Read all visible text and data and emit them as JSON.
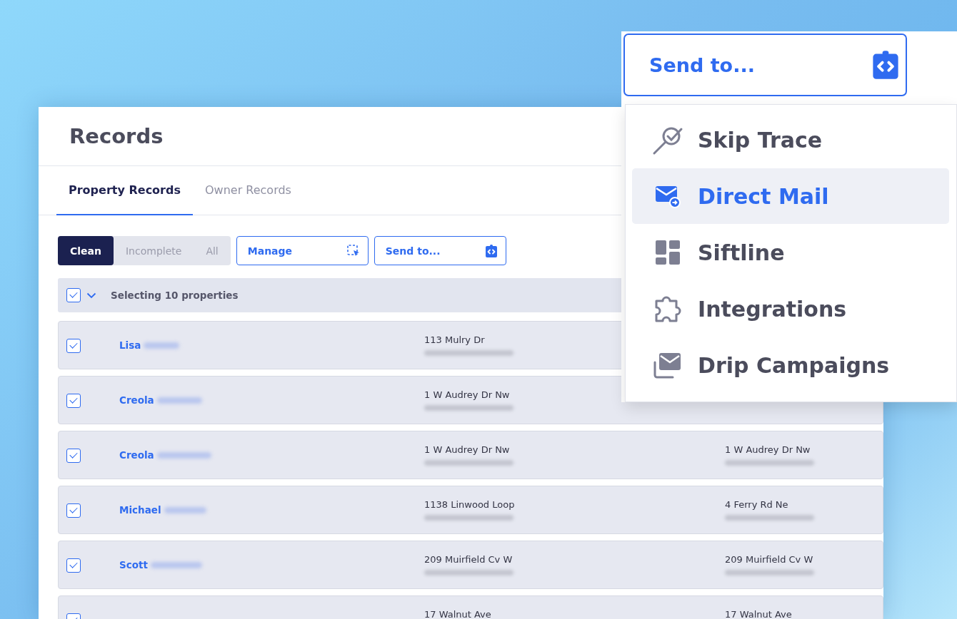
{
  "panel": {
    "title": "Records",
    "tabs": [
      {
        "label": "Property Records",
        "selected": true
      },
      {
        "label": "Owner Records",
        "selected": false
      }
    ],
    "filters": [
      {
        "label": "Clean",
        "selected": true
      },
      {
        "label": "Incomplete",
        "selected": false
      },
      {
        "label": "All",
        "selected": false
      }
    ],
    "actions": [
      {
        "label": "Manage",
        "kind": "manage"
      },
      {
        "label": "Send to...",
        "kind": "send"
      }
    ],
    "selection": {
      "checked": true,
      "label": "Selecting 10 properties"
    },
    "rows": [
      {
        "checked": true,
        "name": "Lisa",
        "property_address": "113 Mulry Dr"
      },
      {
        "checked": true,
        "name": "Creola",
        "property_address": "1 W Audrey Dr Nw"
      },
      {
        "checked": true,
        "name": "Creola",
        "property_address": "1 W Audrey Dr Nw",
        "owner_address": "1 W Audrey Dr Nw"
      },
      {
        "checked": true,
        "name": "Michael",
        "property_address": "1138 Linwood Loop",
        "owner_address": "4 Ferry Rd Ne"
      },
      {
        "checked": true,
        "name": "Scott",
        "property_address": "209 Muirfield Cv W",
        "owner_address": "209 Muirfield Cv W"
      },
      {
        "checked": true,
        "property_address": "17 Walnut Ave",
        "owner_address": "17 Walnut Ave"
      }
    ]
  },
  "send_menu": {
    "label": "Send to...",
    "items": [
      {
        "label": "Skip Trace",
        "kind": "skip-trace",
        "selected": false
      },
      {
        "label": "Direct Mail",
        "kind": "direct-mail",
        "selected": true
      },
      {
        "label": "Siftline",
        "kind": "siftline",
        "selected": false
      },
      {
        "label": "Integrations",
        "kind": "integrations",
        "selected": false
      },
      {
        "label": "Drip Campaigns",
        "kind": "drip",
        "selected": false
      }
    ]
  }
}
